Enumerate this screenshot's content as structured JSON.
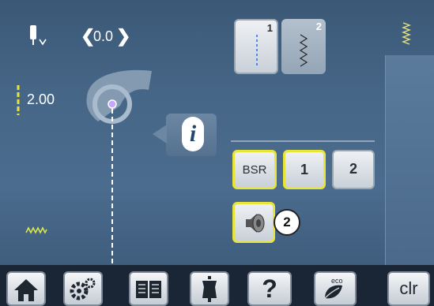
{
  "header": {
    "needle_position": "0.0",
    "stitch_length": "2.00"
  },
  "needle_tabs": [
    {
      "label": "1",
      "selected": true
    },
    {
      "label": "2",
      "selected": false
    }
  ],
  "modes": {
    "bsr": "BSR",
    "mode_1": "1",
    "mode_2": "2"
  },
  "sound_badge": "2",
  "bottom_bar": {
    "clr": "clr",
    "help": "?",
    "eco": "eco"
  },
  "colors": {
    "accent_yellow": "#e8e43a",
    "screen_blue": "#466687",
    "stitch_green": "#d8e84a"
  }
}
